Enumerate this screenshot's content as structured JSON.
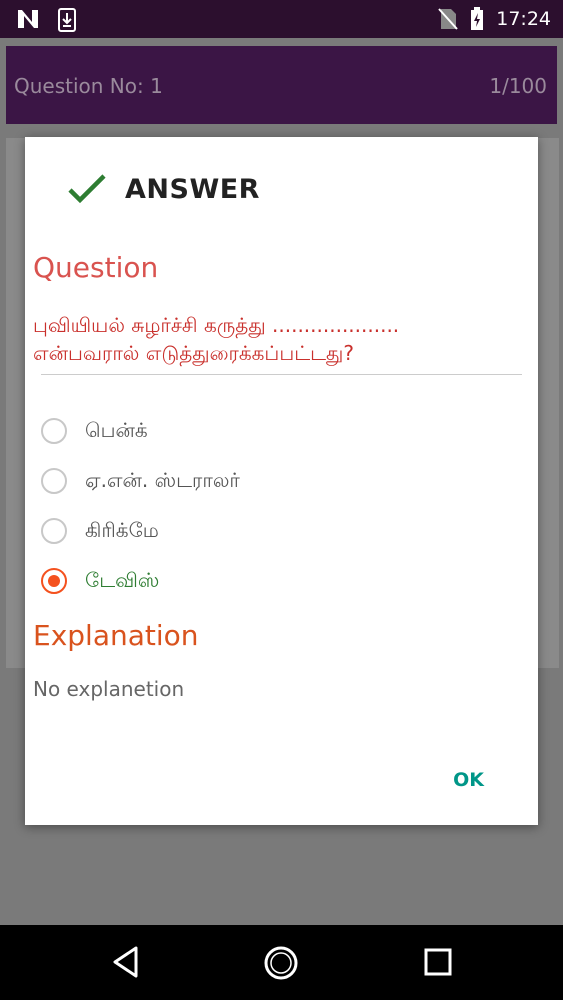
{
  "status_bar": {
    "time": "17:24"
  },
  "toolbar": {
    "question_label": "Question No:  1",
    "counter": "1/100"
  },
  "dialog": {
    "title": "ANSWER",
    "question_heading": "Question",
    "question_text": "புவியியல் சுழர்ச்சி கருத்து .................... என்பவரால் எடுத்துரைக்கப்பட்டது?",
    "options": [
      {
        "label": "பென்க்",
        "selected": false
      },
      {
        "label": "ஏ.என். ஸ்டராலர்",
        "selected": false
      },
      {
        "label": "கிரிக்மே",
        "selected": false
      },
      {
        "label": "டேவிஸ்",
        "selected": true
      }
    ],
    "explanation_heading": "Explanation",
    "explanation_text": "No explanetion",
    "ok_label": "OK"
  },
  "colors": {
    "accent": "#f4511e",
    "ok": "#009688",
    "correct": "#2e7d32",
    "question": "#c9302c"
  }
}
